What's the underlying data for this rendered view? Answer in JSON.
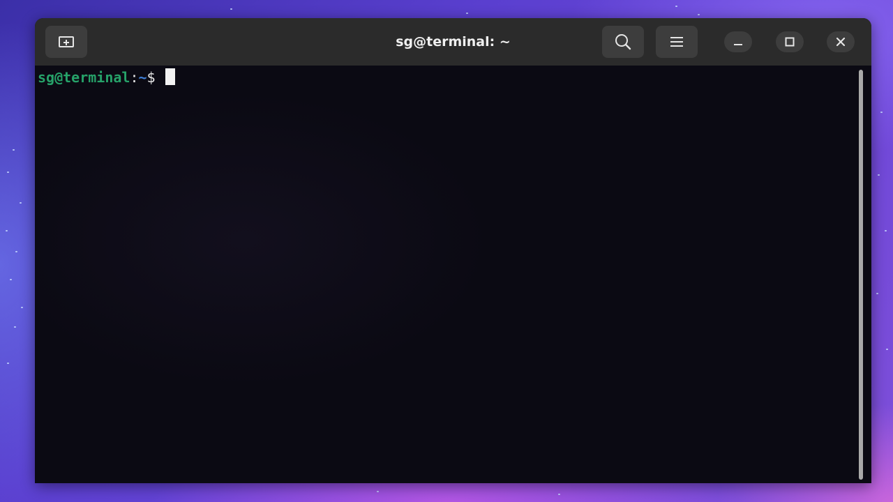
{
  "window": {
    "title": "sg@terminal: ~"
  },
  "toolbar": {
    "new_tab_icon": "new-tab-icon",
    "search_icon": "search-icon",
    "menu_icon": "hamburger-menu-icon"
  },
  "window_controls": {
    "minimize_icon": "minimize-icon",
    "maximize_icon": "maximize-icon",
    "close_icon": "close-icon"
  },
  "terminal": {
    "prompt_user_host": "sg@terminal",
    "prompt_colon": ":",
    "prompt_path": "~",
    "prompt_symbol": "$ ",
    "input": ""
  },
  "colors": {
    "prompt_user": "#26a269",
    "prompt_path": "#3f7fd6",
    "terminal_bg": "#0b0a13",
    "titlebar_bg": "#2b2b2b"
  }
}
